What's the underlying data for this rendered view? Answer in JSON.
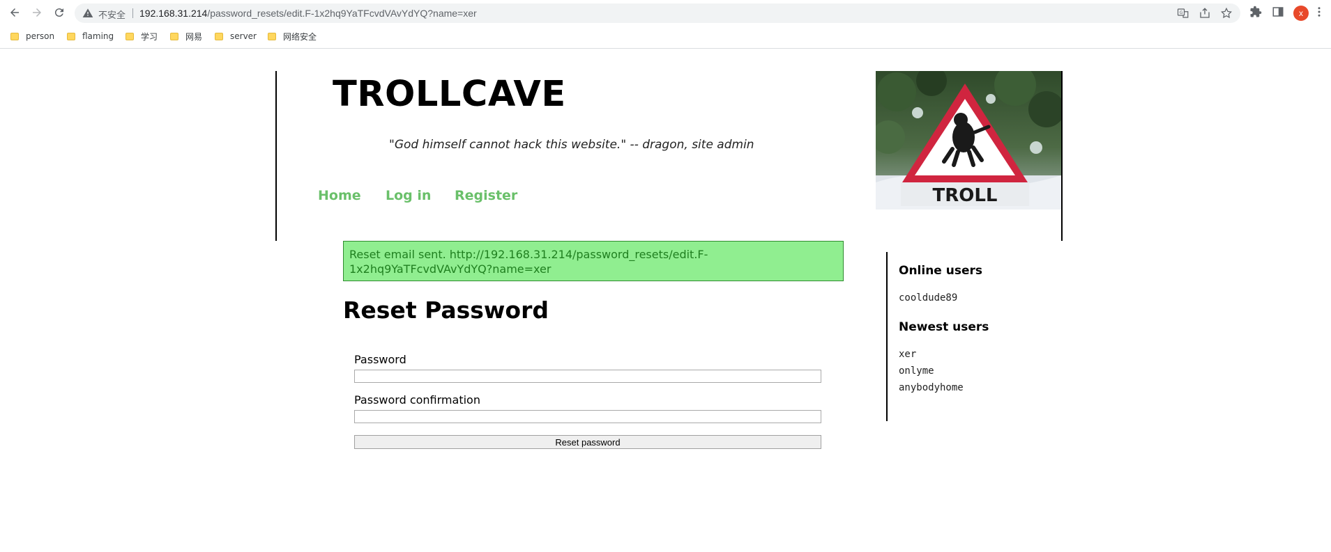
{
  "browser": {
    "security_label": "不安全",
    "url_host": "192.168.31.214",
    "url_path": "/password_resets/edit.F-1x2hq9YaTFcvdVAvYdYQ?name=xer",
    "profile_initial": "x",
    "bookmarks": [
      {
        "label": "person"
      },
      {
        "label": "flaming"
      },
      {
        "label": "学习"
      },
      {
        "label": "网易"
      },
      {
        "label": "server"
      },
      {
        "label": "网络安全"
      }
    ]
  },
  "site": {
    "title": "TROLLCAVE",
    "tagline": "\"God himself cannot hack this website.\" -- dragon, site admin",
    "logo_text": "TROLL",
    "nav": [
      {
        "label": "Home"
      },
      {
        "label": "Log in"
      },
      {
        "label": "Register"
      }
    ]
  },
  "flash": {
    "message": "Reset email sent. http://192.168.31.214/password_resets/edit.F-1x2hq9YaTFcvdVAvYdYQ?name=xer"
  },
  "form": {
    "heading": "Reset Password",
    "password_label": "Password",
    "password_value": "",
    "confirmation_label": "Password confirmation",
    "confirmation_value": "",
    "submit_label": "Reset password"
  },
  "sidebar": {
    "online_heading": "Online users",
    "online_users": [
      "cooldude89"
    ],
    "newest_heading": "Newest users",
    "newest_users": [
      "xer",
      "onlyme",
      "anybodyhome"
    ]
  },
  "colors": {
    "nav_link": "#6ac06a",
    "flash_bg": "#90ee90",
    "flash_text": "#1f7f1f"
  }
}
